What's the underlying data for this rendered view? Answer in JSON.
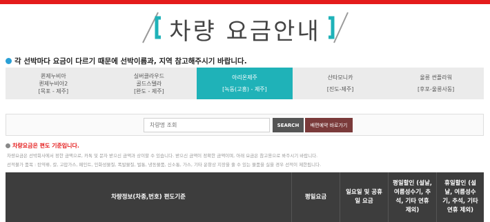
{
  "page": {
    "title": "차량 요금안내"
  },
  "notice": "각 선박마다 요금이 다르기 때문에 선박이름과, 지역 참고해주시기 바랍니다.",
  "tabs": [
    {
      "line1": "퀸제누비아",
      "line2": "퀸제누비아2",
      "line3": "[목포 - 제주]",
      "active": false
    },
    {
      "line1": "실버클라우드",
      "line2": "골드스텔라",
      "line3": "[완도 - 제주]",
      "active": false
    },
    {
      "line1": "아리온제주",
      "line2": "",
      "line3": "[녹동(고흥) - 제주]",
      "active": true
    },
    {
      "line1": "산타모니카",
      "line2": "",
      "line3": "[진도-제주]",
      "active": false
    },
    {
      "line1": "울릉 썬플라워",
      "line2": "",
      "line3": "[후포-울릉사동]",
      "active": false
    }
  ],
  "search": {
    "placeholder": "차량명 조회",
    "search_label": "SEARCH",
    "ship_label": "배편예약 바로가기"
  },
  "info": {
    "title": "차량요금은 편도 기준입니다.",
    "line1": "차량요금은 선박회사에서 정한 금액으로, 카톡 및 문자 받으신 금액과 상이할 수 있습니다. 받으신 금액이 정확한 금액이며, 아래 요금은 참고용으로 봐주시기 바랍니다.",
    "line2": "선적불가 품목 : 탄약류, 칼, 고압가스, 페인트, 인화성물질, 폭발물질, 벌통, 냉동물품, 신소통, 가스, 기타 운항상 지장을 줄 수 있는 물품을 실을 경우 선적이 제한됩니다."
  },
  "table": {
    "headers": [
      "차량정보(차종,번호) 편도기준",
      "평일요금",
      "일요일 및 공휴일 요금",
      "평일할인 (설날, 여름성수기, 추석, 기타 연휴 제외)",
      "휴일할인 (설날, 여름성수기, 추석, 기타 연휴 제외)"
    ]
  },
  "colors": {
    "accent": "#1fb2b8",
    "alert": "#e41b1b",
    "header_bg": "#3d3d3d"
  }
}
